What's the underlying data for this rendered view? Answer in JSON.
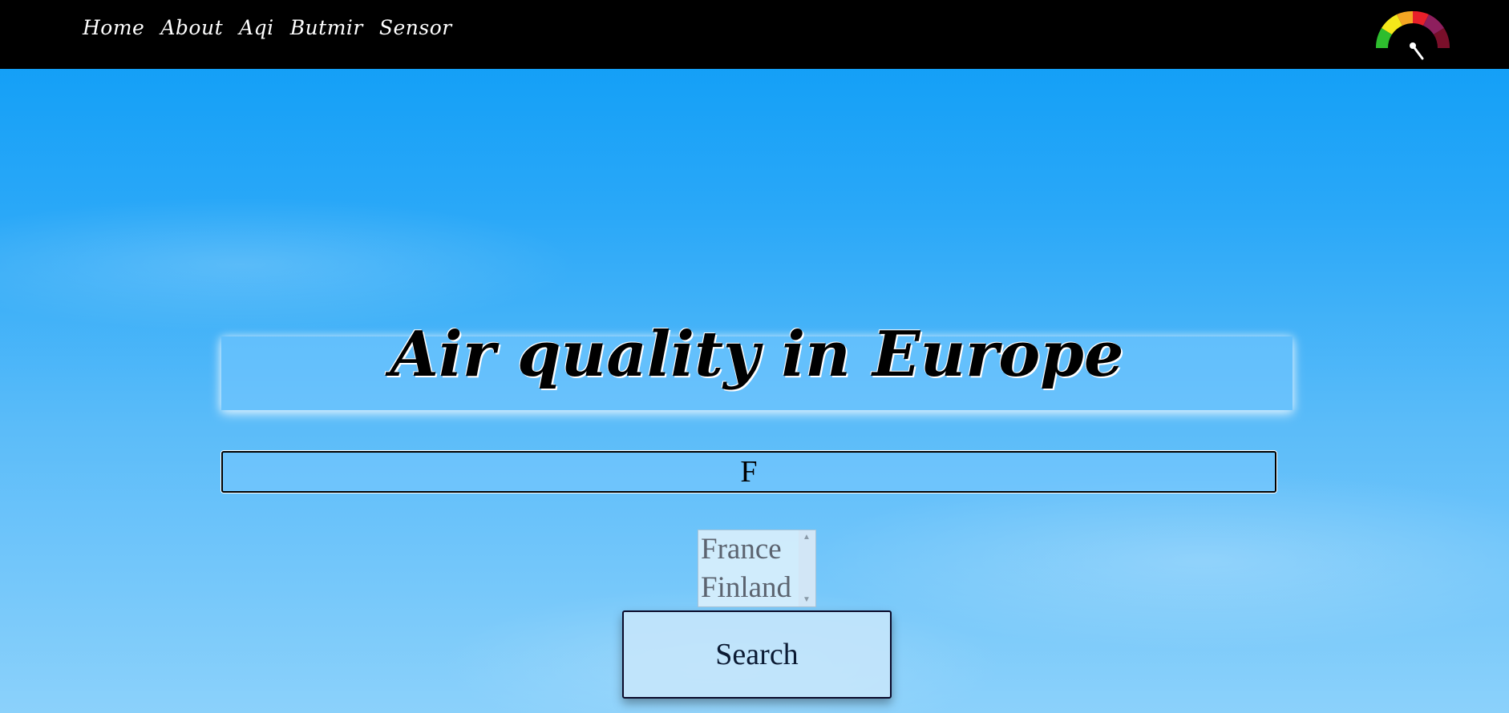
{
  "nav": {
    "links": [
      "Home",
      "About",
      "Aqi",
      "Butmir",
      "Sensor"
    ]
  },
  "main": {
    "title": "Air quality in Europe",
    "search_value": "F",
    "suggestions": [
      "France",
      "Finland"
    ],
    "search_button_label": "Search"
  },
  "colors": {
    "navbar": "#000000",
    "sky_top": "#0a9cf6",
    "sky_bottom": "#8bd1fb"
  },
  "icons": {
    "logo": "aqi-gauge-icon",
    "scroll_up": "scroll-up-icon",
    "scroll_down": "scroll-down-icon"
  }
}
